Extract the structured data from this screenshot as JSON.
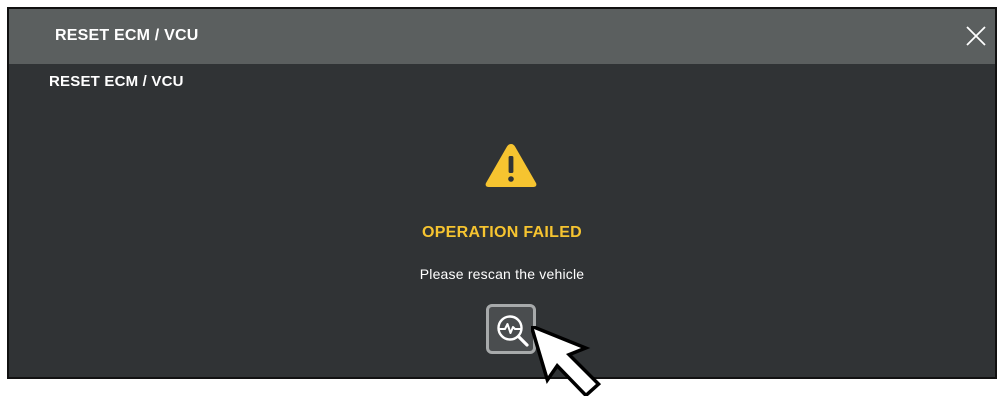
{
  "dialog": {
    "title": "RESET ECM / VCU",
    "close_icon": "close-icon"
  },
  "content": {
    "subtitle": "RESET ECM / VCU",
    "status_icon": "warning-icon",
    "status_title": "OPERATION FAILED",
    "status_message": "Please rescan the vehicle",
    "rescan_icon": "rescan-search-pulse-icon"
  },
  "colors": {
    "dialog_bg": "#303335",
    "titlebar_bg": "#5b5f5f",
    "warning": "#f6c430",
    "button_border": "#a7aaab"
  }
}
